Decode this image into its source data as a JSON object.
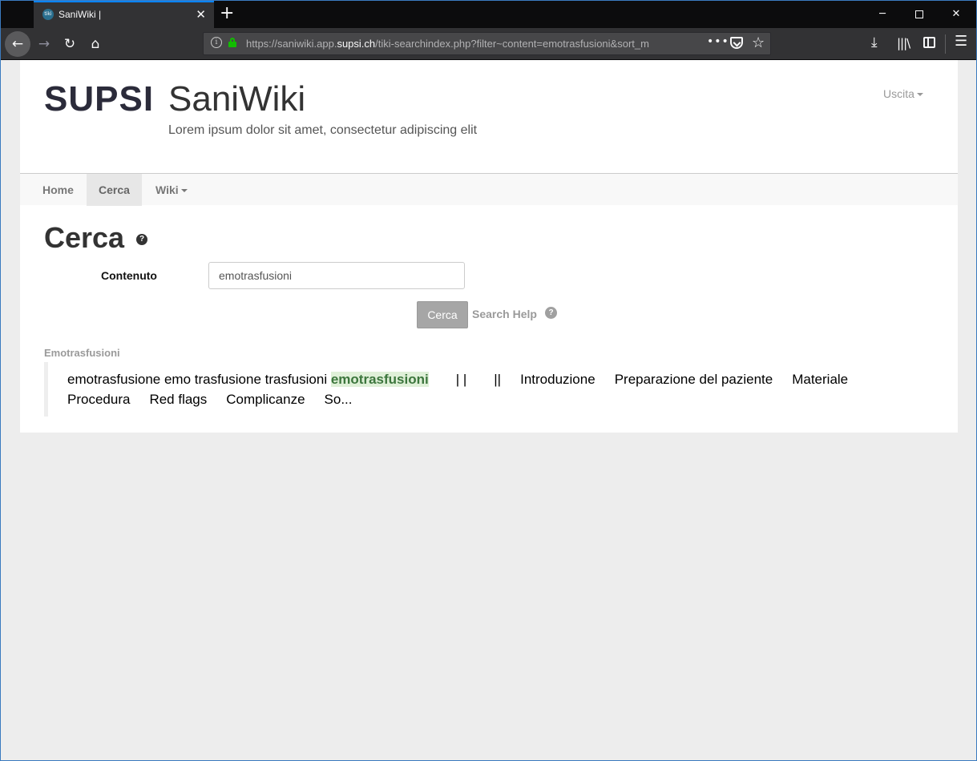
{
  "browser": {
    "tab_title": "SaniWiki |",
    "favicon_text": "tiki",
    "url_prefix": "https://saniwiki.app.",
    "url_domain": "supsi.ch",
    "url_suffix": "/tiki-searchindex.php?filter~content=emotrasfusioni&sort_m",
    "icons": {
      "new_tab": "+",
      "close": "✕",
      "minimize": "─",
      "back": "←",
      "forward": "→",
      "reload": "↻",
      "home": "⌂",
      "more": "•••",
      "star": "☆",
      "download": "⤓",
      "library": "|||\\",
      "menu": "☰"
    }
  },
  "site": {
    "logo": "SUPSI",
    "title": "SaniWiki",
    "subtitle": "Lorem ipsum dolor sit amet, consectetur adipiscing elit",
    "user_menu": "Uscita"
  },
  "nav": {
    "home": "Home",
    "cerca": "Cerca",
    "wiki": "Wiki"
  },
  "search": {
    "heading": "Cerca",
    "field_label": "Contenuto",
    "field_value": "emotrasfusioni",
    "button": "Cerca",
    "help_link": "Search Help",
    "help_icon": "?"
  },
  "results": [
    {
      "title": "Emotrasfusioni",
      "snippet_prefix": "emotrasfusione emo trasfusione trasfusioni",
      "snippet_highlight": "emotrasfusioni",
      "sep1": "| |",
      "sep2": "||",
      "sections_line1": [
        "Introduzione",
        "Preparazione del paziente",
        "Materiale"
      ],
      "sections_line2": [
        "Procedura",
        "Red flags",
        "Complicanze",
        "So..."
      ]
    }
  ]
}
